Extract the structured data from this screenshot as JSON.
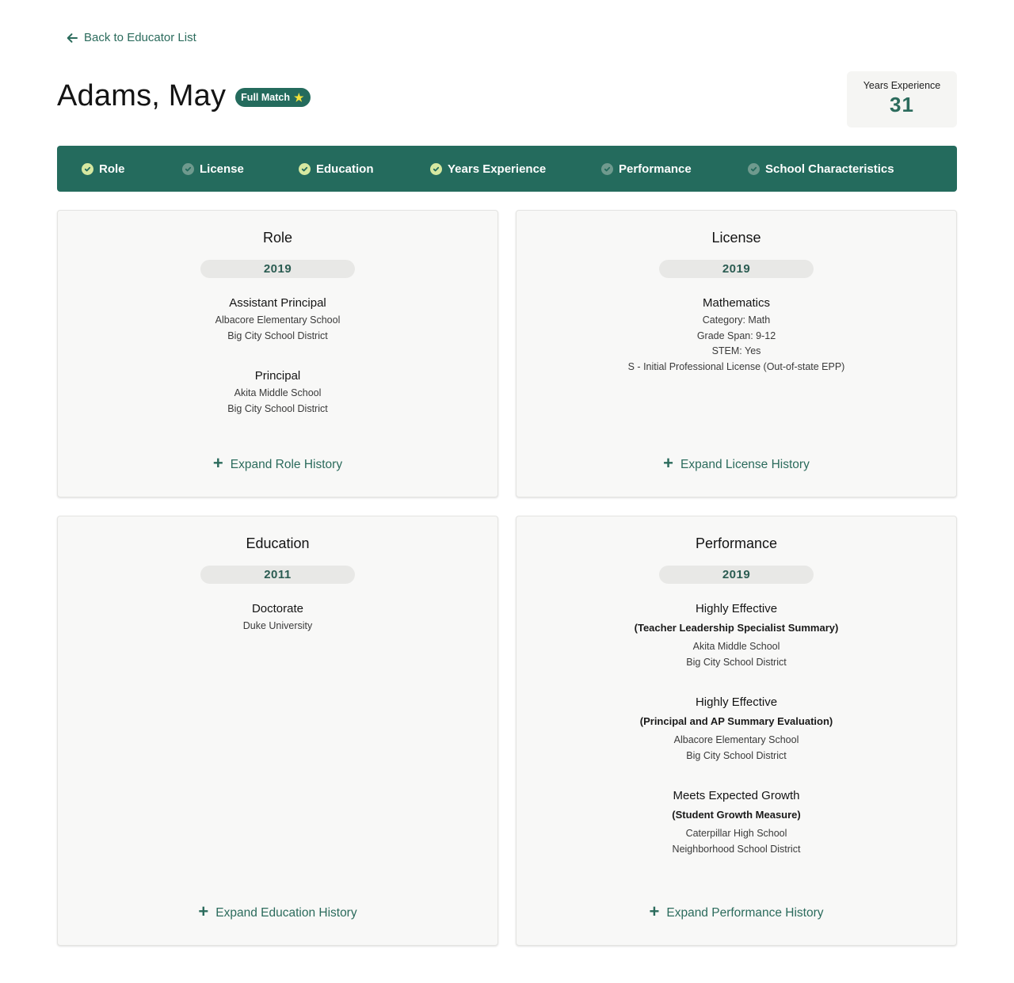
{
  "nav": {
    "back_label": "Back to Educator List"
  },
  "educator": {
    "name": "Adams, May",
    "match_badge": "Full Match"
  },
  "years_experience": {
    "label": "Years Experience",
    "value": "31"
  },
  "criteria": [
    {
      "label": "Role",
      "matched": true
    },
    {
      "label": "License",
      "matched": false
    },
    {
      "label": "Education",
      "matched": true
    },
    {
      "label": "Years Experience",
      "matched": true
    },
    {
      "label": "Performance",
      "matched": false
    },
    {
      "label": "School Characteristics",
      "matched": false
    }
  ],
  "cards": {
    "role": {
      "title": "Role",
      "year": "2019",
      "entries": [
        {
          "title": "Assistant Principal",
          "details": [
            "Albacore Elementary School",
            "Big City School District"
          ]
        },
        {
          "title": "Principal",
          "details": [
            "Akita Middle School",
            "Big City School District"
          ]
        }
      ],
      "expand_label": "Expand Role History"
    },
    "license": {
      "title": "License",
      "year": "2019",
      "entries": [
        {
          "title": "Mathematics",
          "details": [
            "Category: Math",
            "Grade Span: 9-12",
            "STEM: Yes",
            "S - Initial Professional License (Out-of-state EPP)"
          ]
        }
      ],
      "expand_label": "Expand License History"
    },
    "education": {
      "title": "Education",
      "year": "2011",
      "entries": [
        {
          "title": "Doctorate",
          "details": [
            "Duke University"
          ]
        }
      ],
      "expand_label": "Expand Education History"
    },
    "performance": {
      "title": "Performance",
      "year": "2019",
      "entries": [
        {
          "title": "Highly Effective",
          "subtitle": "(Teacher Leadership Specialist Summary)",
          "details": [
            "Akita Middle School",
            "Big City School District"
          ]
        },
        {
          "title": "Highly Effective",
          "subtitle": "(Principal and AP Summary Evaluation)",
          "details": [
            "Albacore Elementary School",
            "Big City School District"
          ]
        },
        {
          "title": "Meets Expected Growth",
          "subtitle": "(Student Growth Measure)",
          "details": [
            "Caterpillar High School",
            "Neighborhood School District"
          ]
        }
      ],
      "expand_label": "Expand Performance History"
    }
  },
  "colors": {
    "brand": "#246b5d",
    "accent_text": "#2b6b5c",
    "check_on": "#d6e8a0",
    "check_off": "#6f9a8e",
    "star": "#f3e23a"
  }
}
